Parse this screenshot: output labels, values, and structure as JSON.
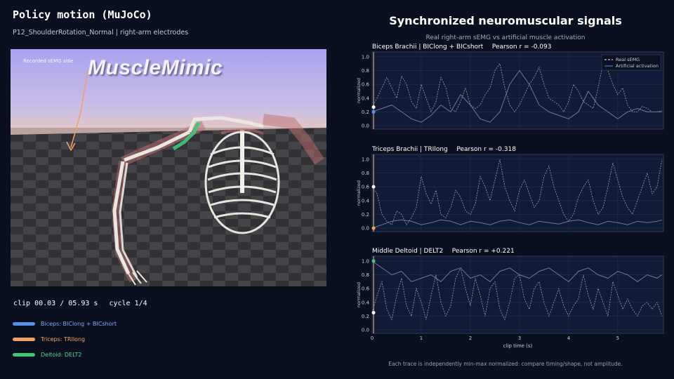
{
  "left": {
    "title": "Policy motion (MuJoCo)",
    "subtitle": "P12_ShoulderRotation_Normal | right-arm electrodes",
    "viewport_label": "Recorded sEMG side",
    "brand": "MuscleMimic",
    "clip_time": "clip 00.03 / 05.93 s",
    "cycle": "cycle 1/4",
    "legend": [
      {
        "label": "Biceps: BIClong + BICshort",
        "color": "#5b8ee6"
      },
      {
        "label": "Triceps: TRIlong",
        "color": "#f0a060"
      },
      {
        "label": "Deltoid: DELT2",
        "color": "#3ec878"
      }
    ]
  },
  "right": {
    "title": "Synchronized neuromuscular signals",
    "subtitle": "Real right-arm sEMG vs artificial muscle activation",
    "footnote": "Each trace is independently min-max normalized: compare timing/shape, not amplitude."
  },
  "chart_data": [
    {
      "type": "line",
      "panel_title": "Biceps Brachii | BIClong + BICshort",
      "pearson": "Pearson r = -0.093",
      "ylabel": "normalized",
      "xlabel": "",
      "xlim": [
        0,
        5.93
      ],
      "ylim": [
        -0.05,
        1.07
      ],
      "yticks": [
        "0.0",
        "0.2",
        "0.4",
        "0.6",
        "0.8",
        "1.0"
      ],
      "legend": [
        "Real sEMG",
        "Artificial activation"
      ],
      "legend_position": "top-right",
      "grid": true,
      "cursor_x": 0.03,
      "marker_color": "#5b8ee6",
      "series": [
        {
          "name": "Real sEMG",
          "style": "dashed",
          "color": "#d8dbe4",
          "x": [
            0,
            0.1,
            0.2,
            0.3,
            0.4,
            0.5,
            0.6,
            0.7,
            0.8,
            0.9,
            1.0,
            1.1,
            1.2,
            1.3,
            1.4,
            1.5,
            1.6,
            1.7,
            1.8,
            1.9,
            2.0,
            2.1,
            2.2,
            2.3,
            2.4,
            2.5,
            2.6,
            2.7,
            2.8,
            2.9,
            3.0,
            3.1,
            3.2,
            3.3,
            3.4,
            3.5,
            3.6,
            3.7,
            3.8,
            3.9,
            4.0,
            4.1,
            4.2,
            4.3,
            4.4,
            4.5,
            4.6,
            4.7,
            4.8,
            4.9,
            5.0,
            5.1,
            5.2,
            5.3,
            5.4,
            5.5,
            5.6,
            5.7,
            5.8,
            5.9
          ],
          "y": [
            0.27,
            0.4,
            0.55,
            0.7,
            0.55,
            0.4,
            0.72,
            0.6,
            0.35,
            0.25,
            0.6,
            0.4,
            0.2,
            0.35,
            0.7,
            0.55,
            0.25,
            0.2,
            0.35,
            0.55,
            0.3,
            0.25,
            0.3,
            0.45,
            0.55,
            0.8,
            0.9,
            0.55,
            0.3,
            0.2,
            0.3,
            0.45,
            0.6,
            0.7,
            0.85,
            0.6,
            0.4,
            0.35,
            0.3,
            0.2,
            0.35,
            0.6,
            0.5,
            0.35,
            0.3,
            0.25,
            0.55,
            0.9,
            0.8,
            0.6,
            0.45,
            0.55,
            0.3,
            0.2,
            0.2,
            0.28,
            0.25,
            0.2,
            0.2,
            0.22
          ]
        },
        {
          "name": "Artificial activation",
          "style": "solid",
          "color": "#6a7aa0",
          "x": [
            0,
            0.2,
            0.4,
            0.6,
            0.8,
            1.0,
            1.2,
            1.4,
            1.6,
            1.8,
            2.0,
            2.2,
            2.4,
            2.6,
            2.8,
            3.0,
            3.2,
            3.4,
            3.6,
            3.8,
            4.0,
            4.2,
            4.4,
            4.6,
            4.8,
            5.0,
            5.2,
            5.4,
            5.6,
            5.8,
            5.9
          ],
          "y": [
            0.2,
            0.25,
            0.3,
            0.2,
            0.1,
            0.05,
            0.15,
            0.3,
            0.2,
            0.45,
            0.3,
            0.1,
            0.05,
            0.2,
            0.6,
            0.8,
            0.6,
            0.3,
            0.2,
            0.15,
            0.1,
            0.2,
            0.5,
            0.3,
            0.2,
            0.1,
            0.2,
            0.25,
            0.2,
            0.2,
            0.2
          ]
        }
      ]
    },
    {
      "type": "line",
      "panel_title": "Triceps Brachii | TRIlong",
      "pearson": "Pearson r = -0.318",
      "ylabel": "normalized",
      "xlabel": "",
      "xlim": [
        0,
        5.93
      ],
      "ylim": [
        -0.05,
        1.07
      ],
      "yticks": [
        "0.0",
        "0.2",
        "0.4",
        "0.6",
        "0.8",
        "1.0"
      ],
      "grid": true,
      "cursor_x": 0.03,
      "marker_color": "#f0a060",
      "series": [
        {
          "name": "Real sEMG",
          "style": "dashed",
          "color": "#d8dbe4",
          "x": [
            0,
            0.1,
            0.2,
            0.3,
            0.4,
            0.5,
            0.6,
            0.7,
            0.8,
            0.9,
            1.0,
            1.1,
            1.2,
            1.3,
            1.4,
            1.5,
            1.6,
            1.7,
            1.8,
            1.9,
            2.0,
            2.1,
            2.2,
            2.3,
            2.4,
            2.5,
            2.6,
            2.7,
            2.8,
            2.9,
            3.0,
            3.1,
            3.2,
            3.3,
            3.4,
            3.5,
            3.6,
            3.7,
            3.8,
            3.9,
            4.0,
            4.1,
            4.2,
            4.3,
            4.4,
            4.5,
            4.6,
            4.7,
            4.8,
            4.9,
            5.0,
            5.1,
            5.2,
            5.3,
            5.4,
            5.5,
            5.6,
            5.7,
            5.8,
            5.9
          ],
          "y": [
            0.6,
            0.5,
            0.2,
            0.1,
            0.05,
            0.25,
            0.2,
            0.05,
            0.15,
            0.3,
            0.75,
            0.5,
            0.35,
            0.55,
            0.2,
            0.15,
            0.3,
            0.55,
            0.45,
            0.25,
            0.2,
            0.35,
            0.75,
            0.6,
            0.4,
            0.7,
            1.0,
            0.6,
            0.4,
            0.25,
            0.55,
            0.7,
            0.5,
            0.3,
            0.4,
            0.75,
            0.9,
            0.6,
            0.4,
            0.2,
            0.1,
            0.2,
            0.45,
            0.6,
            0.7,
            0.4,
            0.2,
            0.3,
            0.6,
            0.95,
            0.7,
            0.45,
            0.3,
            0.2,
            0.4,
            0.6,
            0.8,
            0.5,
            0.6,
            1.0
          ]
        },
        {
          "name": "Artificial activation",
          "style": "solid",
          "color": "#6a7aa0",
          "x": [
            0,
            0.2,
            0.4,
            0.6,
            0.8,
            1.0,
            1.2,
            1.4,
            1.6,
            1.8,
            2.0,
            2.2,
            2.4,
            2.6,
            2.8,
            3.0,
            3.2,
            3.4,
            3.6,
            3.8,
            4.0,
            4.2,
            4.4,
            4.6,
            4.8,
            5.0,
            5.2,
            5.4,
            5.6,
            5.8,
            5.9
          ],
          "y": [
            0.0,
            0.05,
            0.1,
            0.12,
            0.1,
            0.05,
            0.08,
            0.12,
            0.1,
            0.05,
            0.1,
            0.08,
            0.05,
            0.1,
            0.12,
            0.08,
            0.05,
            0.1,
            0.08,
            0.06,
            0.1,
            0.12,
            0.08,
            0.05,
            0.1,
            0.08,
            0.05,
            0.1,
            0.08,
            0.1,
            0.12
          ]
        }
      ]
    },
    {
      "type": "line",
      "panel_title": "Middle Deltoid | DELT2",
      "pearson": "Pearson r = +0.221",
      "ylabel": "normalized",
      "xlabel": "clip time (s)",
      "xlim": [
        0,
        5.93
      ],
      "ylim": [
        -0.05,
        1.07
      ],
      "yticks": [
        "0.0",
        "0.2",
        "0.4",
        "0.6",
        "0.8",
        "1.0"
      ],
      "xticks": [
        "0",
        "1",
        "2",
        "3",
        "4",
        "5"
      ],
      "grid": true,
      "cursor_x": 0.03,
      "marker_color": "#3ec878",
      "series": [
        {
          "name": "Real sEMG",
          "style": "dashed",
          "color": "#d8dbe4",
          "x": [
            0,
            0.1,
            0.2,
            0.3,
            0.4,
            0.5,
            0.6,
            0.7,
            0.8,
            0.9,
            1.0,
            1.1,
            1.2,
            1.3,
            1.4,
            1.5,
            1.6,
            1.7,
            1.8,
            1.9,
            2.0,
            2.1,
            2.2,
            2.3,
            2.4,
            2.5,
            2.6,
            2.7,
            2.8,
            2.9,
            3.0,
            3.1,
            3.2,
            3.3,
            3.4,
            3.5,
            3.6,
            3.7,
            3.8,
            3.9,
            4.0,
            4.1,
            4.2,
            4.3,
            4.4,
            4.5,
            4.6,
            4.7,
            4.8,
            4.9,
            5.0,
            5.1,
            5.2,
            5.3,
            5.4,
            5.5,
            5.6,
            5.7,
            5.8,
            5.9
          ],
          "y": [
            0.25,
            0.5,
            0.7,
            0.3,
            0.15,
            0.5,
            0.75,
            0.35,
            0.2,
            0.6,
            0.4,
            0.15,
            0.5,
            0.8,
            0.4,
            0.2,
            0.35,
            0.75,
            0.9,
            0.6,
            0.35,
            0.75,
            0.5,
            0.2,
            0.6,
            0.7,
            0.3,
            0.15,
            0.4,
            0.75,
            0.8,
            0.45,
            0.3,
            0.6,
            0.7,
            0.4,
            0.2,
            0.4,
            0.6,
            0.35,
            0.2,
            0.35,
            0.45,
            0.8,
            0.5,
            0.3,
            0.6,
            0.4,
            0.2,
            0.7,
            0.5,
            0.3,
            0.45,
            0.3,
            0.2,
            0.35,
            0.4,
            0.3,
            0.4,
            0.2
          ]
        },
        {
          "name": "Artificial activation",
          "style": "solid",
          "color": "#6a7aa0",
          "x": [
            0,
            0.2,
            0.4,
            0.6,
            0.8,
            1.0,
            1.2,
            1.4,
            1.6,
            1.8,
            2.0,
            2.2,
            2.4,
            2.6,
            2.8,
            3.0,
            3.2,
            3.4,
            3.6,
            3.8,
            4.0,
            4.2,
            4.4,
            4.6,
            4.8,
            5.0,
            5.2,
            5.4,
            5.6,
            5.8,
            5.9
          ],
          "y": [
            1.0,
            0.9,
            0.8,
            0.85,
            0.7,
            0.75,
            0.8,
            0.7,
            0.85,
            0.9,
            0.75,
            0.8,
            0.7,
            0.85,
            0.9,
            0.8,
            0.75,
            0.85,
            0.9,
            0.8,
            0.7,
            0.85,
            0.9,
            0.8,
            0.75,
            0.85,
            0.8,
            0.7,
            0.8,
            0.75,
            0.8
          ]
        }
      ]
    }
  ]
}
